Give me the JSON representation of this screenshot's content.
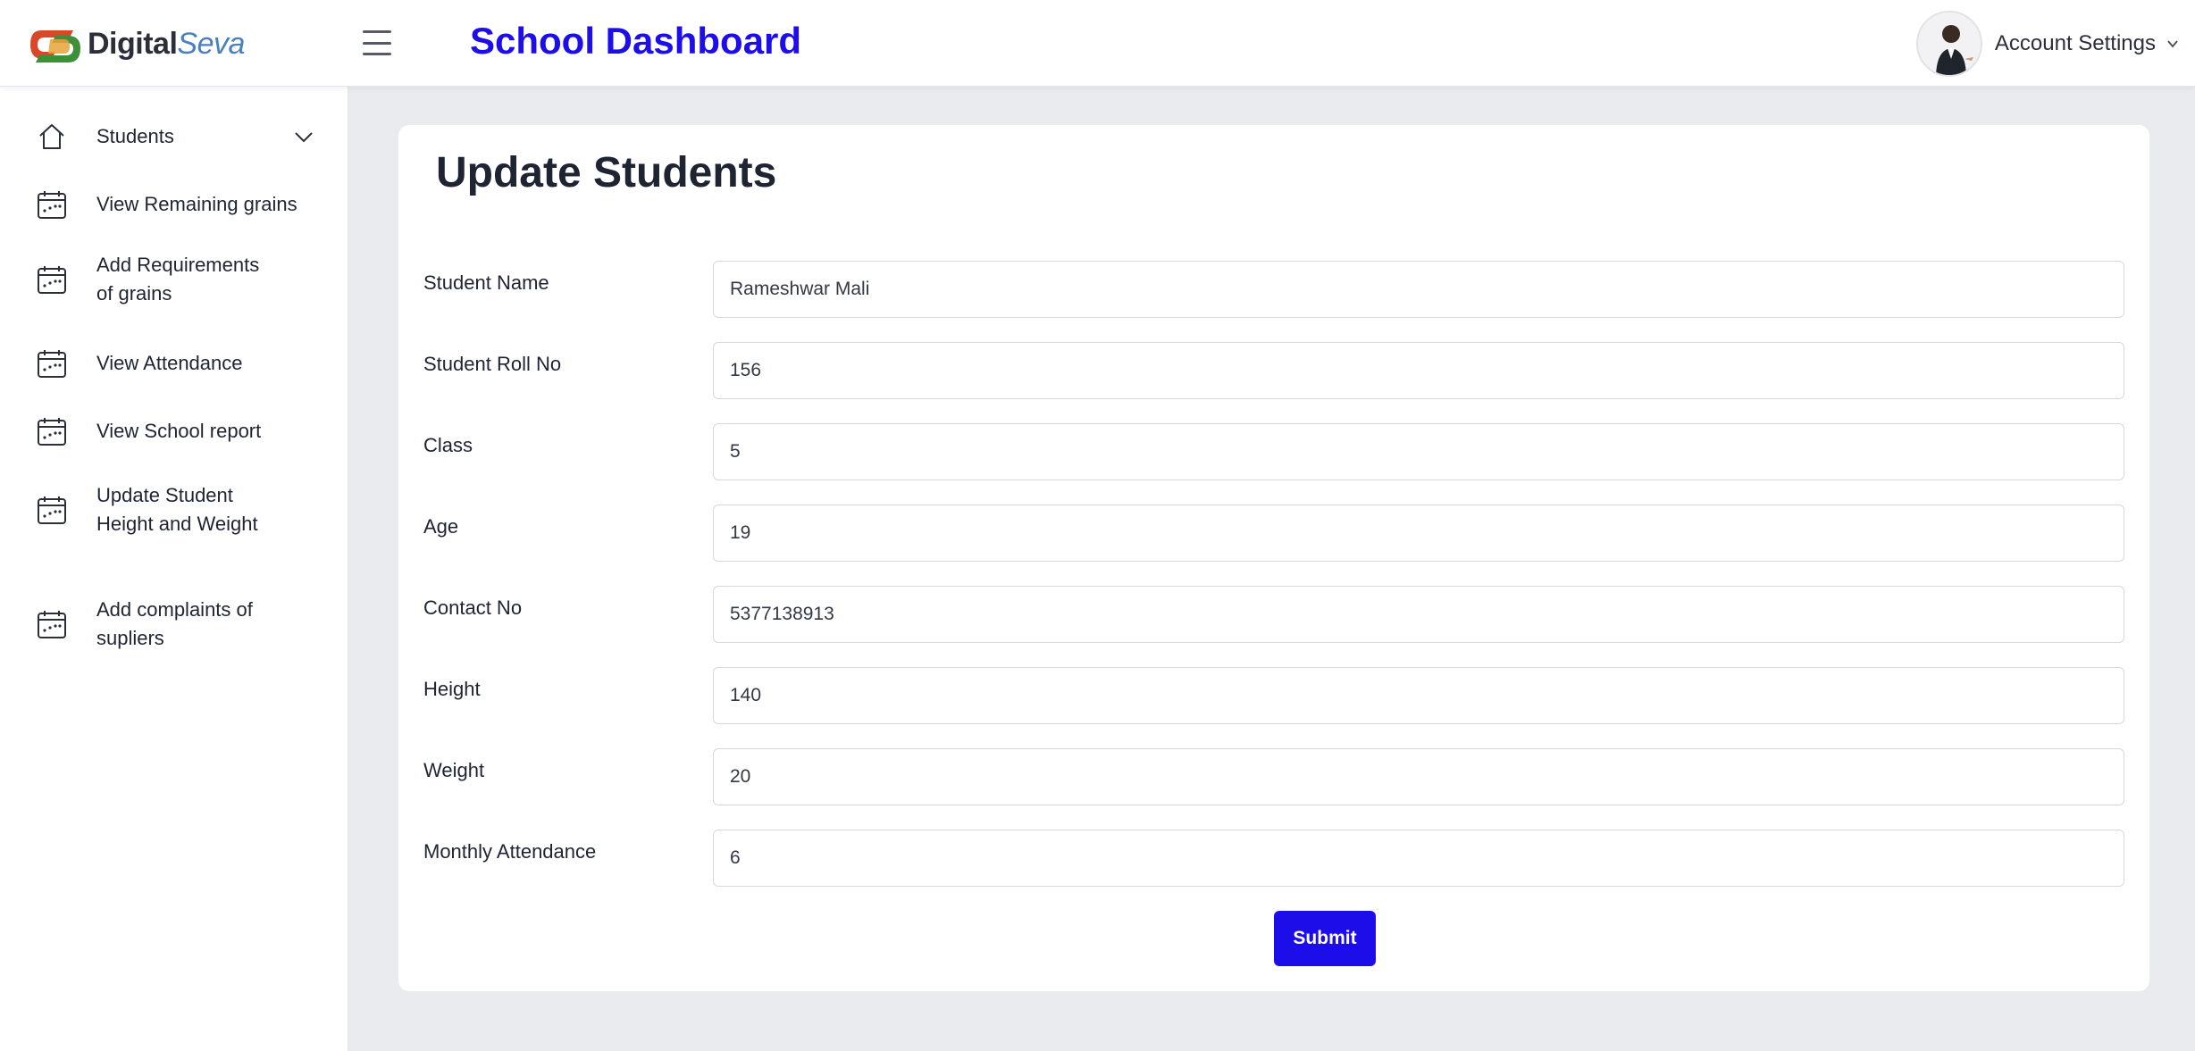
{
  "brand": {
    "name_part1": "Digital",
    "name_part2": "Seva",
    "accent": "#1d0de8"
  },
  "header": {
    "title": "School Dashboard",
    "account_label": "Account Settings"
  },
  "sidebar": {
    "items": [
      {
        "label": "Students",
        "icon": "home-icon",
        "has_submenu": true
      },
      {
        "label": "View Remaining grains",
        "icon": "calendar-icon"
      },
      {
        "label": "Add Requirements of grains",
        "icon": "calendar-icon"
      },
      {
        "label": "View Attendance",
        "icon": "calendar-icon"
      },
      {
        "label": "View School report",
        "icon": "calendar-icon"
      },
      {
        "label": "Update Student Height and Weight",
        "icon": "calendar-icon"
      },
      {
        "label": "Add complaints of supliers",
        "icon": "calendar-icon"
      }
    ]
  },
  "form": {
    "title": "Update Students",
    "fields": [
      {
        "label": "Student Name",
        "value": "Rameshwar Mali"
      },
      {
        "label": "Student Roll No",
        "value": "156"
      },
      {
        "label": "Class",
        "value": "5"
      },
      {
        "label": "Age",
        "value": "19"
      },
      {
        "label": "Contact No",
        "value": "5377138913"
      },
      {
        "label": "Height",
        "value": "140"
      },
      {
        "label": "Weight",
        "value": "20"
      },
      {
        "label": "Monthly Attendance",
        "value": "6"
      }
    ],
    "submit_label": "Submit"
  }
}
